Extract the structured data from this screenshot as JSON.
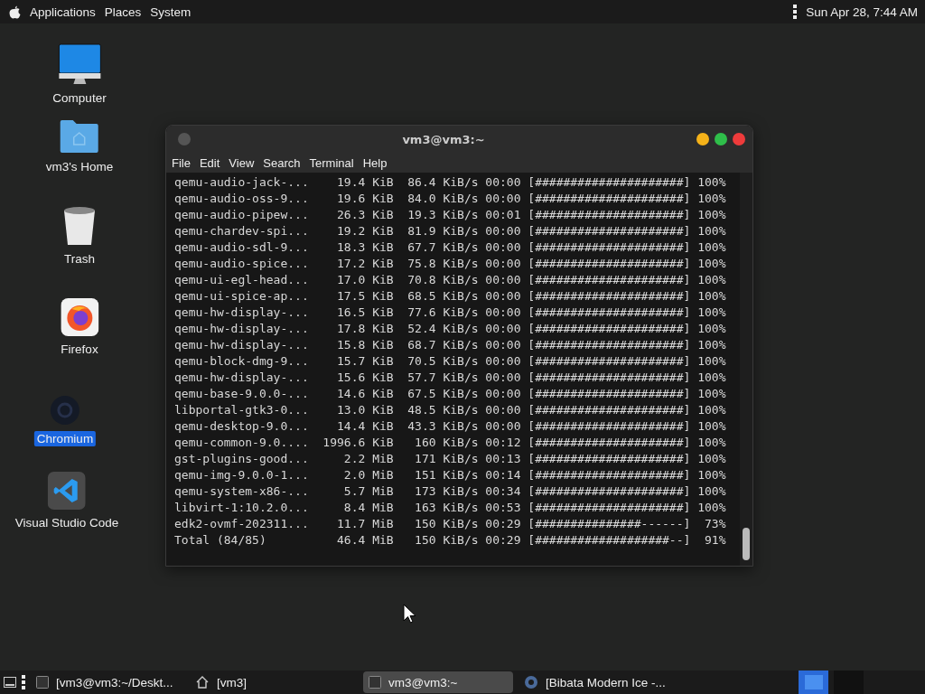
{
  "top_panel": {
    "menus": [
      "Applications",
      "Places",
      "System"
    ],
    "clock": "Sun Apr 28, 7:44 AM"
  },
  "desktop_icons": [
    {
      "label": "Computer",
      "kind": "computer",
      "selected": false
    },
    {
      "label": "vm3's Home",
      "kind": "home",
      "selected": false
    },
    {
      "label": "Trash",
      "kind": "trash",
      "selected": false
    },
    {
      "label": "Firefox",
      "kind": "firefox",
      "selected": false
    },
    {
      "label": "Chromium",
      "kind": "chromium",
      "selected": true
    },
    {
      "label": "Visual Studio Code",
      "kind": "vscode",
      "selected": false
    }
  ],
  "terminal": {
    "title": "vm3@vm3:~",
    "menu": [
      "File",
      "Edit",
      "View",
      "Search",
      "Terminal",
      "Help"
    ],
    "lines": [
      "qemu-audio-jack-...    19.4 KiB  86.4 KiB/s 00:00 [#####################] 100%",
      "qemu-audio-oss-9...    19.6 KiB  84.0 KiB/s 00:00 [#####################] 100%",
      "qemu-audio-pipew...    26.3 KiB  19.3 KiB/s 00:01 [#####################] 100%",
      "qemu-chardev-spi...    19.2 KiB  81.9 KiB/s 00:00 [#####################] 100%",
      "qemu-audio-sdl-9...    18.3 KiB  67.7 KiB/s 00:00 [#####################] 100%",
      "qemu-audio-spice...    17.2 KiB  75.8 KiB/s 00:00 [#####################] 100%",
      "qemu-ui-egl-head...    17.0 KiB  70.8 KiB/s 00:00 [#####################] 100%",
      "qemu-ui-spice-ap...    17.5 KiB  68.5 KiB/s 00:00 [#####################] 100%",
      "qemu-hw-display-...    16.5 KiB  77.6 KiB/s 00:00 [#####################] 100%",
      "qemu-hw-display-...    17.8 KiB  52.4 KiB/s 00:00 [#####################] 100%",
      "qemu-hw-display-...    15.8 KiB  68.7 KiB/s 00:00 [#####################] 100%",
      "qemu-block-dmg-9...    15.7 KiB  70.5 KiB/s 00:00 [#####################] 100%",
      "qemu-hw-display-...    15.6 KiB  57.7 KiB/s 00:00 [#####################] 100%",
      "qemu-base-9.0.0-...    14.6 KiB  67.5 KiB/s 00:00 [#####################] 100%",
      "libportal-gtk3-0...    13.0 KiB  48.5 KiB/s 00:00 [#####################] 100%",
      "qemu-desktop-9.0...    14.4 KiB  43.3 KiB/s 00:00 [#####################] 100%",
      "qemu-common-9.0....  1996.6 KiB   160 KiB/s 00:12 [#####################] 100%",
      "gst-plugins-good...     2.2 MiB   171 KiB/s 00:13 [#####################] 100%",
      "qemu-img-9.0.0-1...     2.0 MiB   151 KiB/s 00:14 [#####################] 100%",
      "qemu-system-x86-...     5.7 MiB   173 KiB/s 00:34 [#####################] 100%",
      "libvirt-1:10.2.0...     8.4 MiB   163 KiB/s 00:53 [#####################] 100%",
      "edk2-ovmf-202311...    11.7 MiB   150 KiB/s 00:29 [###############------]  73%",
      "Total (84/85)          46.4 MiB   150 KiB/s 00:29 [###################--]  91%"
    ]
  },
  "taskbar": {
    "items": [
      {
        "label": "[vm3@vm3:~/Deskt...",
        "kind": "terminal",
        "selected": false
      },
      {
        "label": "[vm3]",
        "kind": "home",
        "selected": false
      },
      {
        "label": "vm3@vm3:~",
        "kind": "terminal",
        "selected": true
      },
      {
        "label": "[Bibata Modern Ice -...",
        "kind": "chromium",
        "selected": false
      }
    ],
    "workspaces": [
      {
        "selected": true
      },
      {
        "selected": false
      }
    ]
  }
}
